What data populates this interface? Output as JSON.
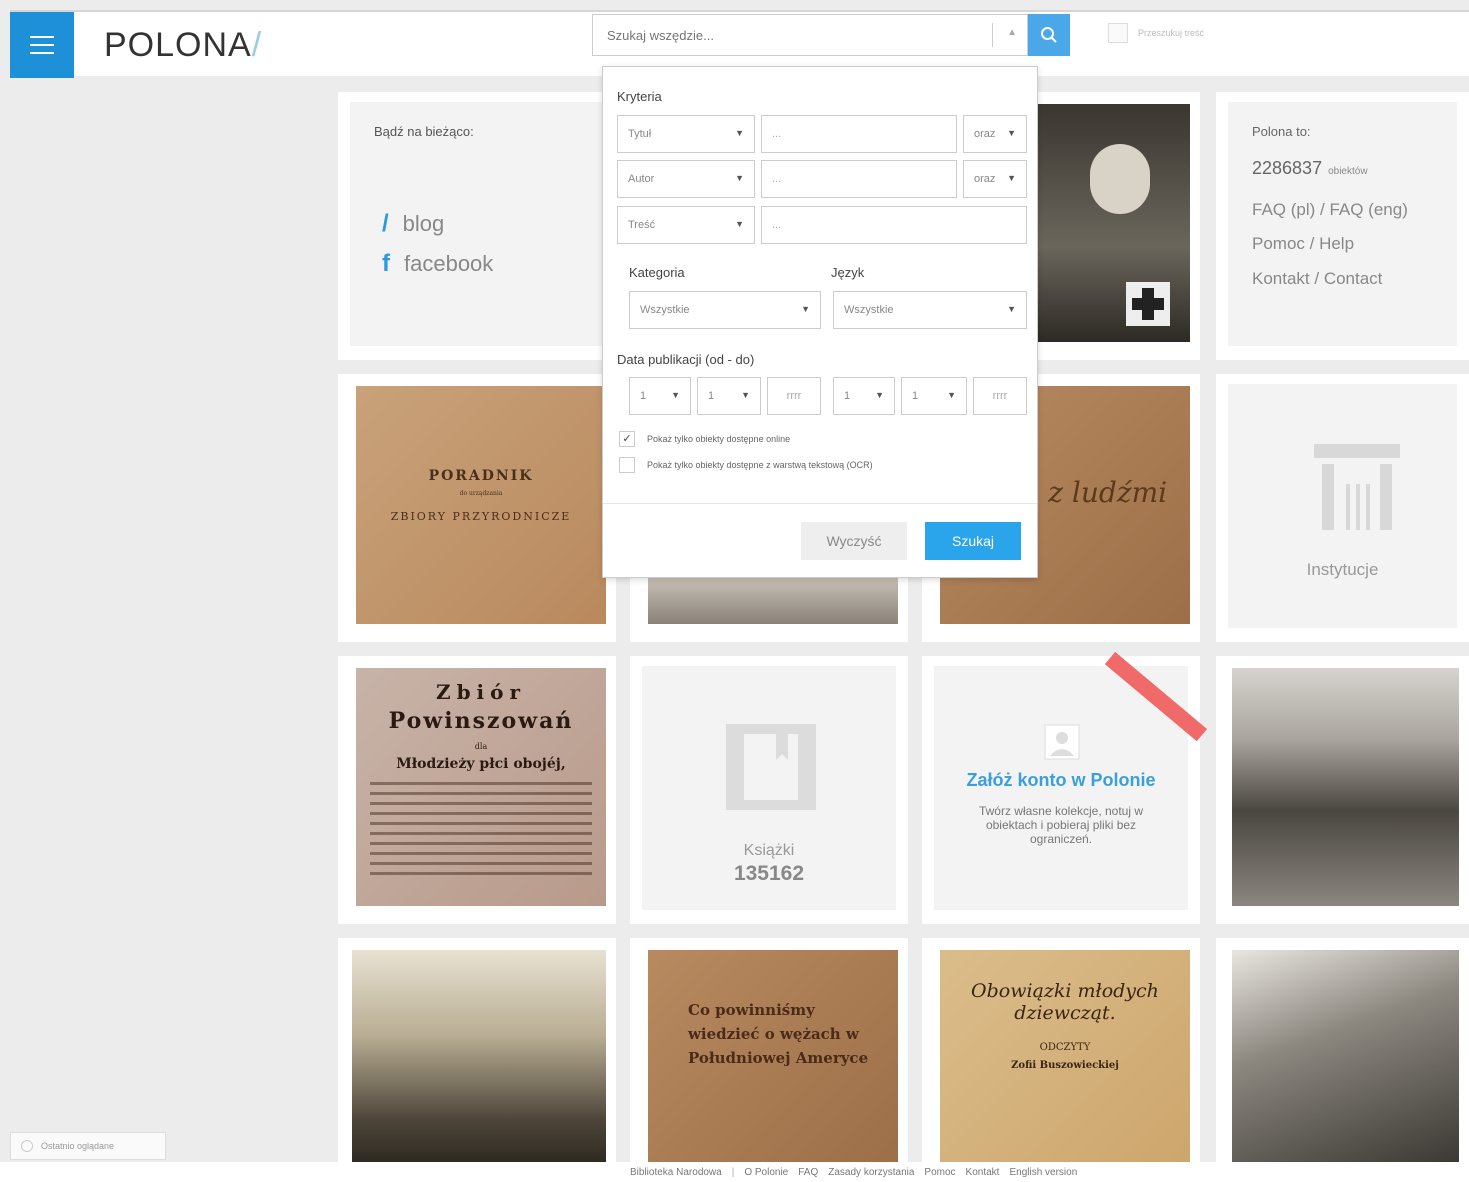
{
  "header": {
    "logo": "POLONA",
    "logo_slash": "/",
    "search_placeholder": "Szukaj wszędzie...",
    "advanced_label": "Przeszukuj treść"
  },
  "news": {
    "title": "Bądź na bieżąco:",
    "blog_icon": "/",
    "blog": "blog",
    "facebook_icon": "f",
    "facebook": "facebook"
  },
  "polona_info": {
    "title": "Polona to:",
    "count": "2286837",
    "count_unit": "obiektów",
    "faq": "FAQ (pl) / FAQ (eng)",
    "help": "Pomoc / Help",
    "contact": "Kontakt / Contact"
  },
  "institutions": {
    "label": "Instytucje"
  },
  "books": {
    "label": "Książki",
    "count": "135162"
  },
  "account": {
    "title": "Załóż konto w Polonie",
    "desc": "Twórz własne kolekcje, notuj w obiektach i pobieraj pliki bez ograniczeń."
  },
  "scans": {
    "poradnik_title": "PORADNIK",
    "poradnik_sub": "do urządzania",
    "poradnik_line": "ZBIORY PRZYRODNICZE",
    "zbior_1": "Zbiór",
    "zbior_2": "Powinszowań",
    "zbior_3": "dla",
    "zbior_4": "Młodzieży płci obojéj,",
    "zycie": "Życie z ludźmi",
    "co_title": "Co powinniśmy wiedzieć o wężach w Południowej Ameryce",
    "obowiazki": "Obowiązki młodych dziewcząt.",
    "obowiazki_sub": "ODCZYTY",
    "obowiazki_author": "Zofii Buszowieckiej"
  },
  "search_panel": {
    "criteria_label": "Kryteria",
    "rows": [
      {
        "field": "Tytuł",
        "value": "...",
        "op": "oraz"
      },
      {
        "field": "Autor",
        "value": "...",
        "op": "oraz"
      },
      {
        "field": "Treść",
        "value": "..."
      }
    ],
    "category_label": "Kategoria",
    "category_value": "Wszystkie",
    "language_label": "Język",
    "language_value": "Wszystkie",
    "date_label": "Data publikacji (od - do)",
    "date_day": "1",
    "date_month": "1",
    "date_year": "rrrr",
    "online_only": "Pokaż tylko obiekty dostępne online",
    "ocr_only": "Pokaż tylko obiekty dostępne z warstwą tekstową (OCR)",
    "clear": "Wyczyść",
    "search": "Szukaj"
  },
  "recent": {
    "label": "Ostatnio oglądane"
  },
  "footer": {
    "links": [
      "Biblioteka Narodowa",
      "O Polonie",
      "FAQ",
      "Zasady korzystania",
      "Pomoc",
      "Kontakt",
      "English version"
    ]
  },
  "colors": {
    "accent": "#1e90d8",
    "search_btn": "#4aa8e8",
    "account_title": "#3a9fdc",
    "ribbon": "#f06a6a"
  }
}
